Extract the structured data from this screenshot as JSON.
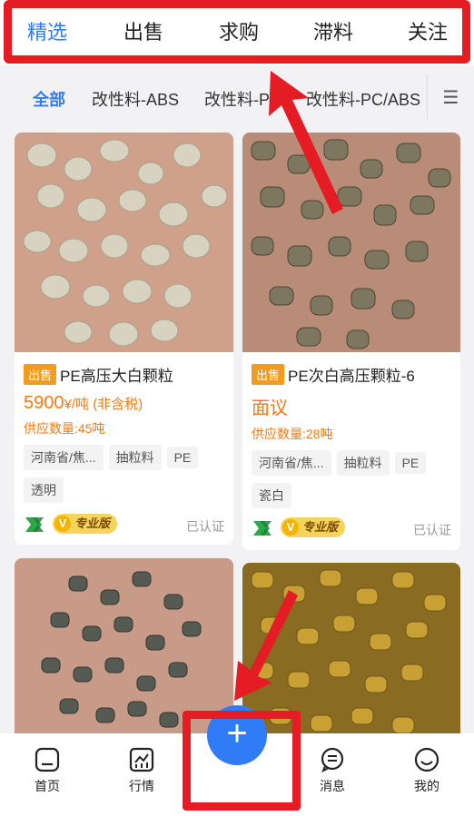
{
  "top_tabs": [
    "精选",
    "出售",
    "求购",
    "滞料",
    "关注"
  ],
  "categories": {
    "items": [
      "全部",
      "改性料-ABS",
      "改性料-P",
      "改性料-PC/ABS"
    ],
    "menu_icon": "menu-icon"
  },
  "products": [
    {
      "badge": "出售",
      "name": "PE高压大白颗粒",
      "price_value": "5900",
      "price_unit": "¥/吨 (非含税)",
      "qty": "供应数量:45吨",
      "tags": [
        "河南省/焦...",
        "抽粒料",
        "PE",
        "透明"
      ],
      "pro_label": "专业版",
      "verified": "已认证",
      "image_colors": [
        "#c9c3b0",
        "#b9b39e",
        "#e0dccb"
      ]
    },
    {
      "badge": "出售",
      "name": "PE次白高压颗粒-6",
      "price_text": "面议",
      "qty": "供应数量:28吨",
      "tags": [
        "河南省/焦...",
        "抽粒料",
        "PE",
        "瓷白"
      ],
      "pro_label": "专业版",
      "verified": "已认证",
      "image_colors": [
        "#6f6a55",
        "#8c866a",
        "#4d4a3d"
      ]
    },
    {
      "image_colors": [
        "#4b5049",
        "#6a7065",
        "#c89a88"
      ]
    },
    {
      "image_colors": [
        "#a9872b",
        "#c49c32",
        "#6d561e"
      ]
    }
  ],
  "bottom_nav": [
    {
      "label": "首页",
      "icon": "home-icon"
    },
    {
      "label": "行情",
      "icon": "chart-icon"
    },
    {
      "label": "",
      "icon": "plus-icon",
      "plus": "+"
    },
    {
      "label": "消息",
      "icon": "message-icon"
    },
    {
      "label": "我的",
      "icon": "profile-icon"
    }
  ],
  "accent_color": "#2f7cf6",
  "price_color": "#f47a13",
  "annotation_color": "#e51c23"
}
